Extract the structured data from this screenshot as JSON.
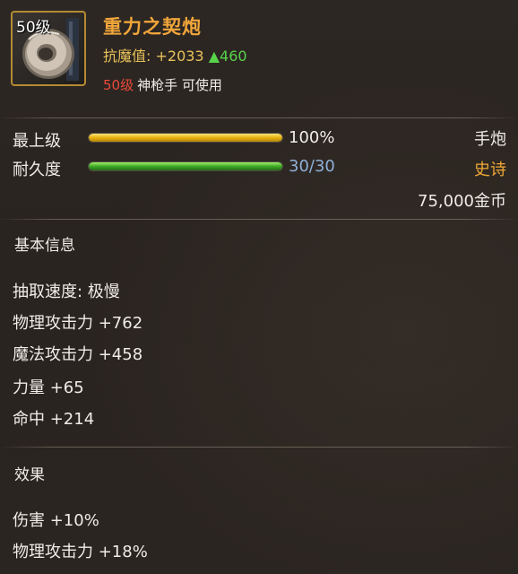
{
  "item": {
    "icon_level": "50级",
    "name": "重力之契炮",
    "resist_label": "抗魔值: ",
    "resist_value": "+2033",
    "resist_delta": "▲460",
    "req_level": "50级",
    "req_class": "神枪手 可使用"
  },
  "stats": {
    "max_level_label": "最上级",
    "max_level_value": "100%",
    "max_level_fraction": 1.0,
    "durability_label": "耐久度",
    "durability_value": "30/30",
    "durability_fraction": 1.0
  },
  "meta": {
    "type": "手炮",
    "rarity": "史诗",
    "price": "75,000金币"
  },
  "basic": {
    "title": "基本信息",
    "lines": [
      "抽取速度: 极慢",
      "物理攻击力 +762",
      "魔法攻击力 +458",
      "力量 +65",
      "命中 +214"
    ]
  },
  "effects": {
    "title": "效果",
    "lines": [
      "伤害 +10%",
      "物理攻击力 +18%"
    ]
  },
  "colors": {
    "name": "#f1a63a",
    "rarity": "#f0a835",
    "frame": "#b58a34",
    "delta": "#58d34a",
    "req_level": "#e94a3a"
  },
  "icons": {
    "item": "hand-cannon-icon"
  }
}
